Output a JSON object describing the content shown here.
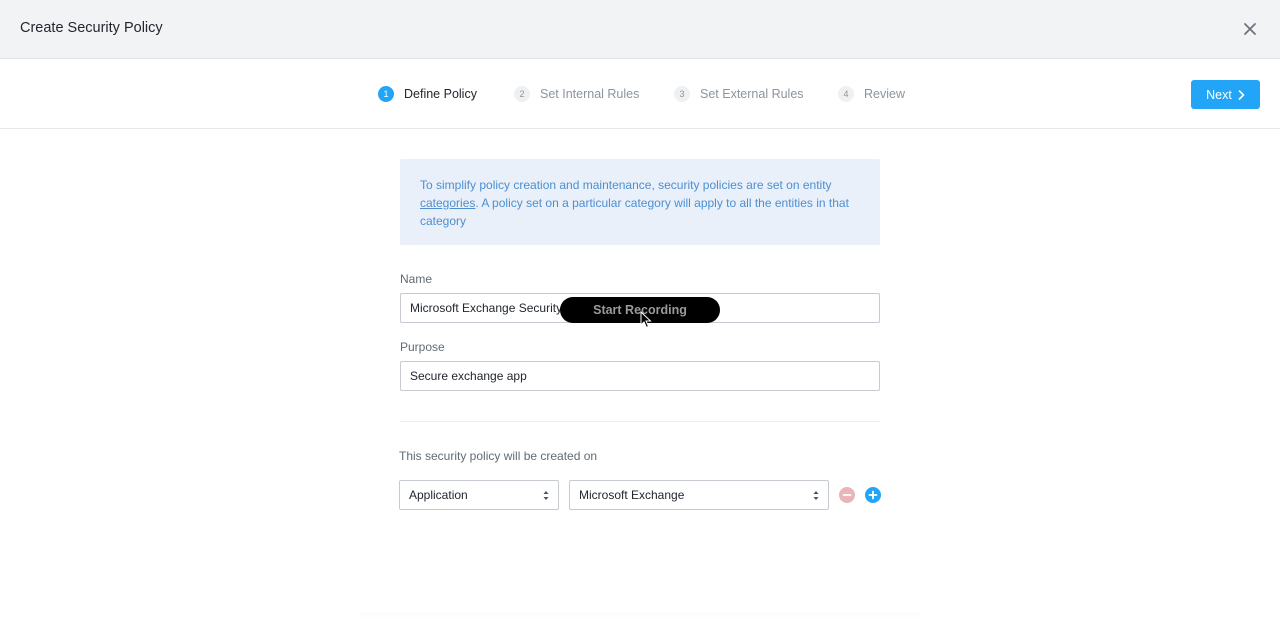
{
  "header": {
    "title": "Create Security Policy"
  },
  "wizard": {
    "steps": [
      {
        "num": "1",
        "label": "Define Policy"
      },
      {
        "num": "2",
        "label": "Set Internal Rules"
      },
      {
        "num": "3",
        "label": "Set External Rules"
      },
      {
        "num": "4",
        "label": "Review"
      }
    ],
    "next_label": "Next"
  },
  "info": {
    "text_before": "To simplify policy creation and maintenance, security policies are set on entity ",
    "link": "categories",
    "text_after": ". A policy set on a particular category will apply to all the entities in that category"
  },
  "form": {
    "name_label": "Name",
    "name_value": "Microsoft Exchange Security",
    "purpose_label": "Purpose",
    "purpose_value": "Secure exchange app",
    "created_on_label": "This security policy will be created on",
    "category_key": "Application",
    "category_value": "Microsoft Exchange"
  },
  "overlay": {
    "recording_label": "Start Recording"
  },
  "colors": {
    "accent": "#22a5f7",
    "info_bg": "#e9f0f9",
    "info_text": "#4c8fd1",
    "remove": "#e8b6b6"
  },
  "icons": {
    "close": "close-icon",
    "next": "chevron-right-icon",
    "select_arrows": "sort-arrows-icon",
    "remove": "minus-icon",
    "add": "plus-icon",
    "cursor": "mouse-pointer-icon"
  }
}
